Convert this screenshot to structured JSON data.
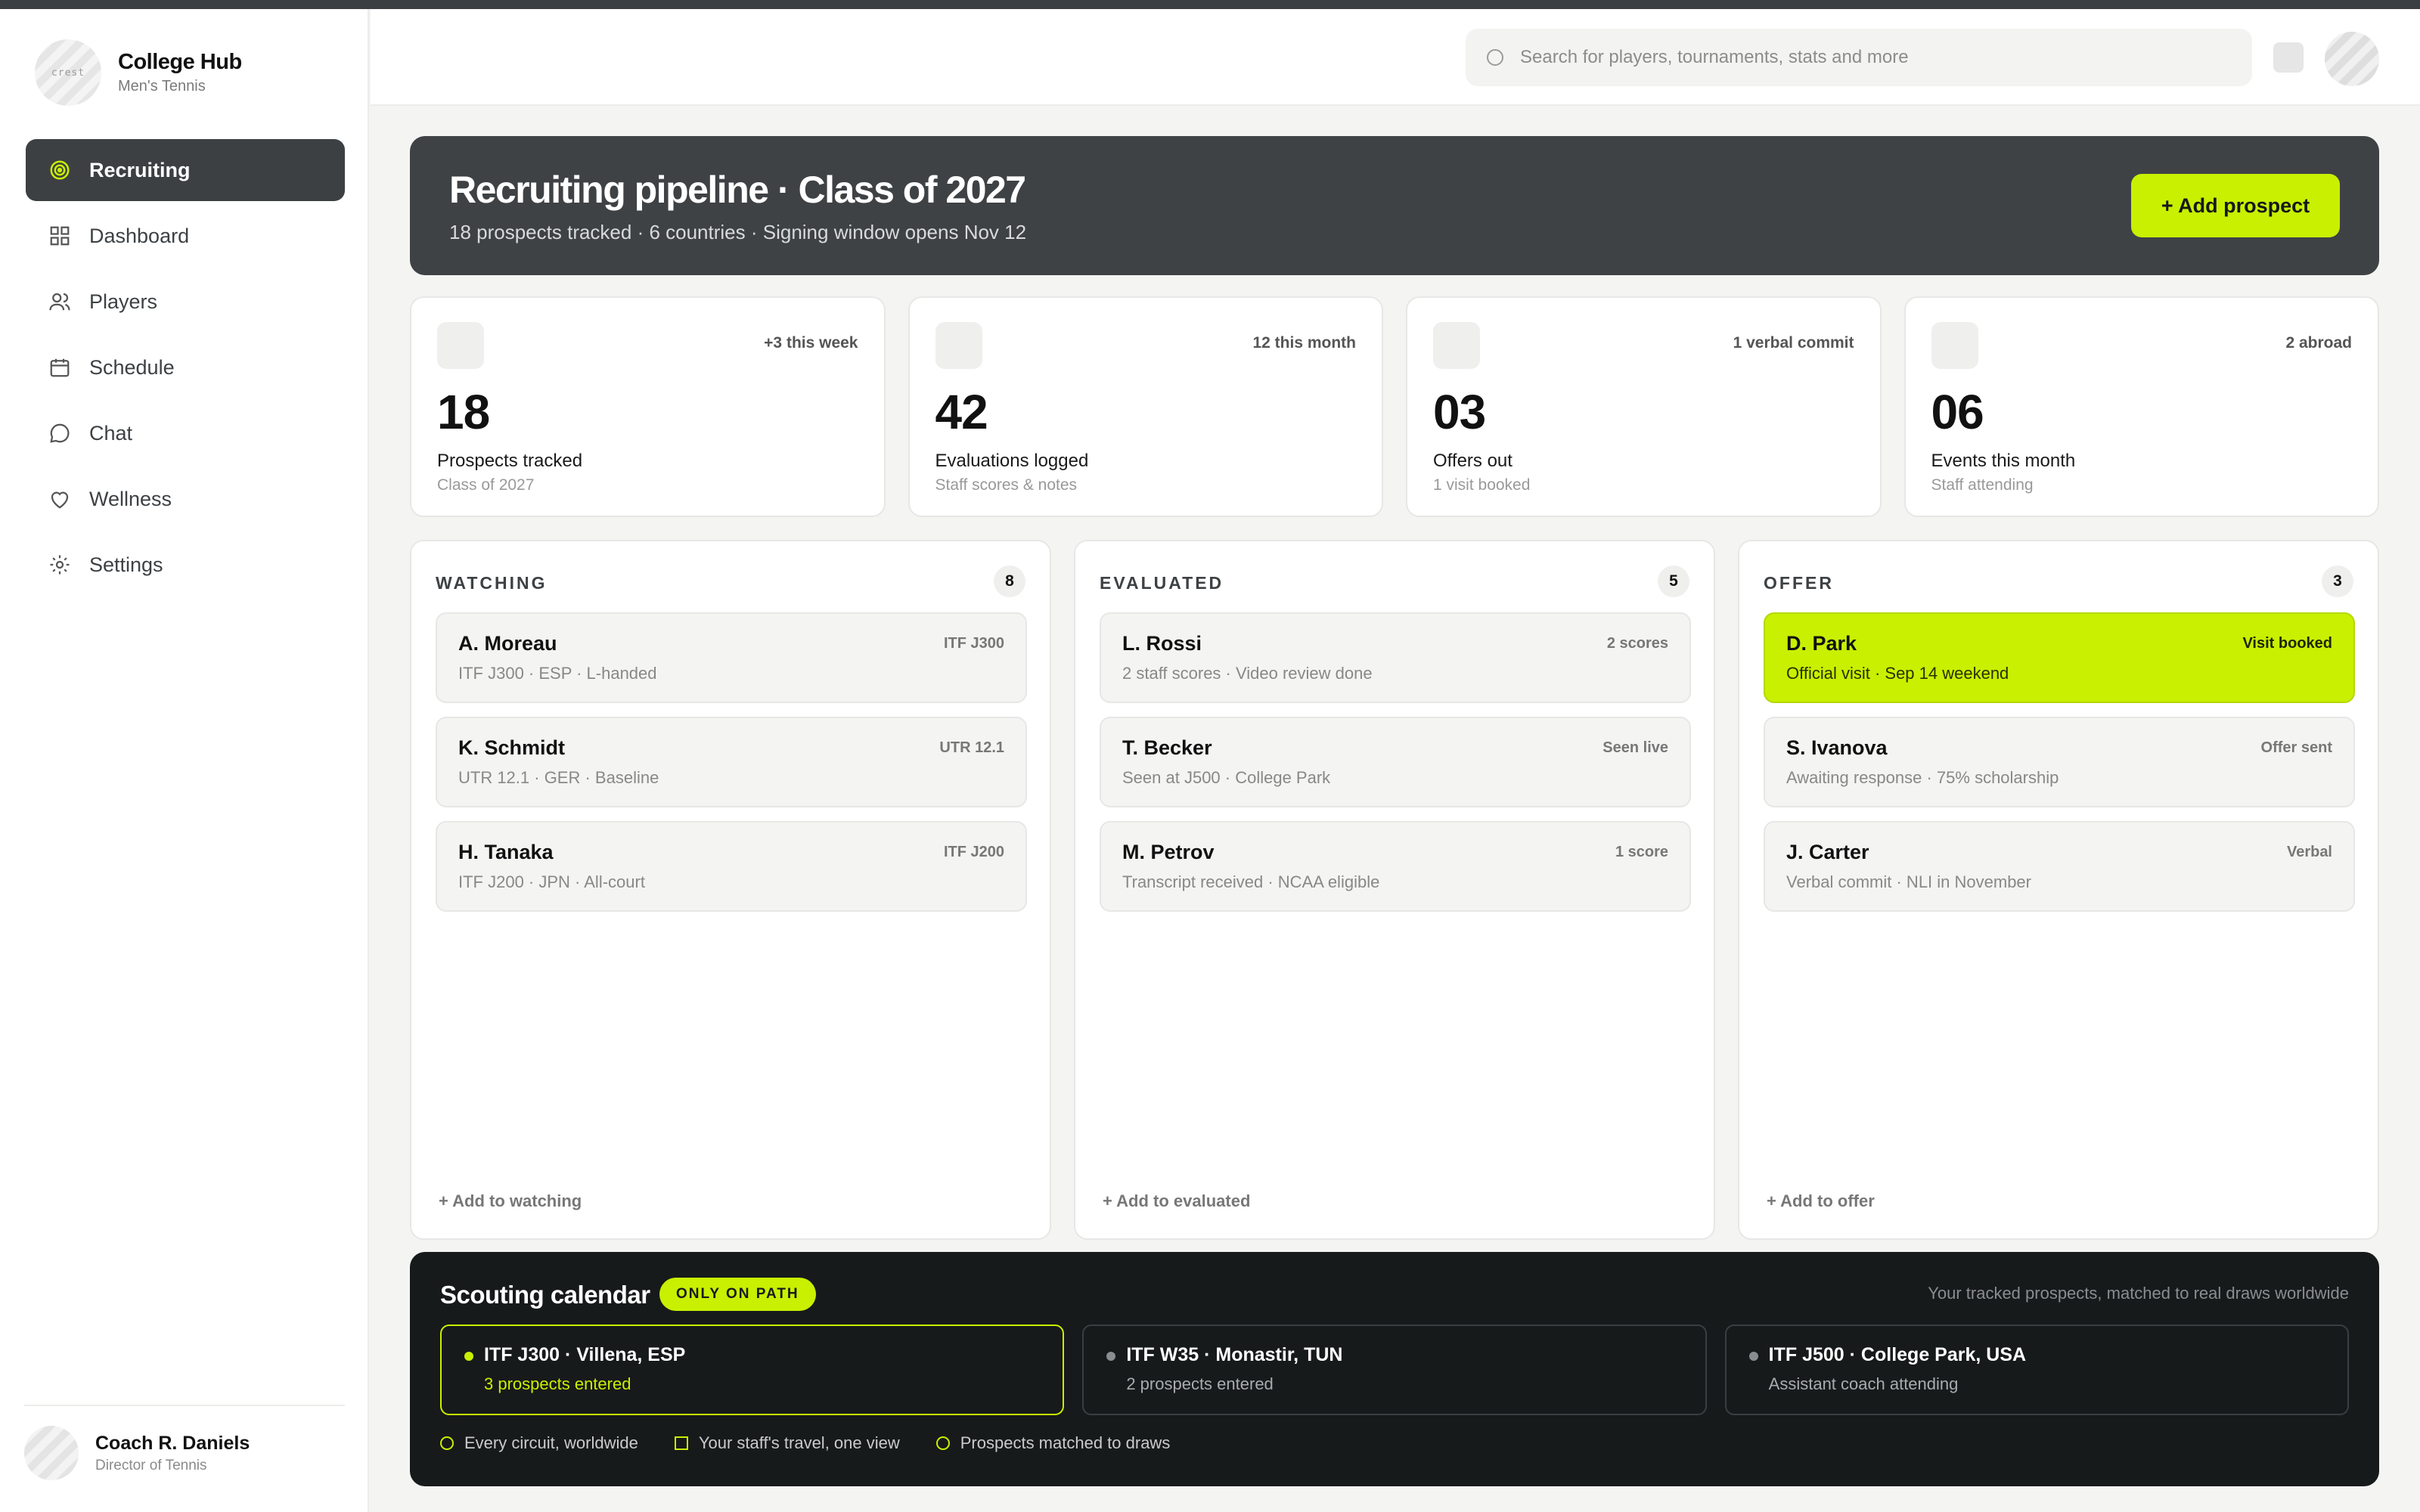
{
  "brand": {
    "crest_text": "crest",
    "title": "College Hub",
    "subtitle": "Men's Tennis"
  },
  "nav": [
    {
      "label": "Recruiting",
      "icon": "target-icon",
      "active": true
    },
    {
      "label": "Dashboard",
      "icon": "grid-icon"
    },
    {
      "label": "Players",
      "icon": "users-icon"
    },
    {
      "label": "Schedule",
      "icon": "calendar-icon"
    },
    {
      "label": "Chat",
      "icon": "chat-icon"
    },
    {
      "label": "Wellness",
      "icon": "heart-icon"
    },
    {
      "label": "Settings",
      "icon": "gear-icon"
    }
  ],
  "user": {
    "name": "Coach R. Daniels",
    "role": "Director of Tennis"
  },
  "search": {
    "placeholder": "Search for players, tournaments, stats and more"
  },
  "hero": {
    "title": "Recruiting pipeline · Class of 2027",
    "subtitle": "18 prospects tracked · 6 countries · Signing window opens Nov 12",
    "button": "+ Add prospect"
  },
  "stats": [
    {
      "delta": "+3 this week",
      "value": "18",
      "label": "Prospects tracked",
      "sub": "Class of 2027"
    },
    {
      "delta": "12 this month",
      "value": "42",
      "label": "Evaluations logged",
      "sub": "Staff scores & notes"
    },
    {
      "delta": "1 verbal commit",
      "value": "03",
      "label": "Offers out",
      "sub": "1 visit booked"
    },
    {
      "delta": "2 abroad",
      "value": "06",
      "label": "Events this month",
      "sub": "Staff attending"
    }
  ],
  "columns": [
    {
      "title": "WATCHING",
      "count": "8",
      "add": "+ Add to watching",
      "cards": [
        {
          "name": "A. Moreau",
          "meta": "ITF J300 · ESP · L-handed",
          "tag": "ITF J300"
        },
        {
          "name": "K. Schmidt",
          "meta": "UTR 12.1 · GER · Baseline",
          "tag": "UTR 12.1"
        },
        {
          "name": "H. Tanaka",
          "meta": "ITF J200 · JPN · All-court",
          "tag": "ITF J200"
        }
      ]
    },
    {
      "title": "EVALUATED",
      "count": "5",
      "add": "+ Add to evaluated",
      "cards": [
        {
          "name": "L. Rossi",
          "meta": "2 staff scores · Video review done",
          "tag": "2 scores"
        },
        {
          "name": "T. Becker",
          "meta": "Seen at J500 · College Park",
          "tag": "Seen live"
        },
        {
          "name": "M. Petrov",
          "meta": "Transcript received · NCAA eligible",
          "tag": "1 score"
        }
      ]
    },
    {
      "title": "OFFER",
      "count": "3",
      "add": "+ Add to offer",
      "cards": [
        {
          "name": "D. Park",
          "meta": "Official visit · Sep 14 weekend",
          "tag": "Visit booked",
          "highlight": true
        },
        {
          "name": "S. Ivanova",
          "meta": "Awaiting response · 75% scholarship",
          "tag": "Offer sent"
        },
        {
          "name": "J. Carter",
          "meta": "Verbal commit · NLI in November",
          "tag": "Verbal"
        }
      ]
    }
  ],
  "scouting": {
    "title": "Scouting calendar",
    "badge": "ONLY ON PATH",
    "note": "Your tracked prospects, matched to real draws worldwide",
    "events": [
      {
        "name": "ITF J300 · Villena, ESP",
        "sub": "3 prospects entered",
        "selected": true
      },
      {
        "name": "ITF W35 · Monastir, TUN",
        "sub": "2 prospects entered"
      },
      {
        "name": "ITF J500 · College Park, USA",
        "sub": "Assistant coach attending"
      }
    ],
    "features": [
      "Every circuit, worldwide",
      "Your staff's travel, one view",
      "Prospects matched to draws"
    ]
  },
  "colors": {
    "accent": "#c8f000",
    "dark": "#3e4245",
    "panel": "#171a1b"
  }
}
